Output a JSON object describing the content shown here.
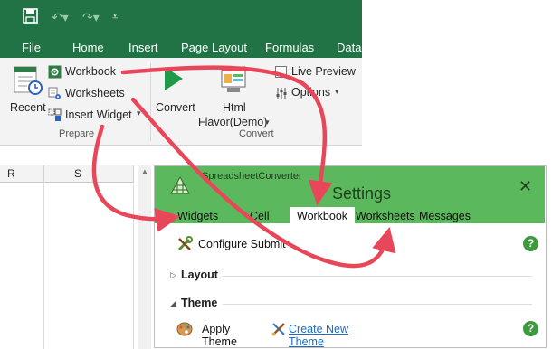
{
  "colors": {
    "excel_green": "#217346",
    "pane_green": "#5cb85c",
    "arrow_red": "#e8475a",
    "link_blue": "#1a6ec7"
  },
  "excel": {
    "qat": {
      "save_icon": "save-icon",
      "undo_icon": "undo-icon",
      "redo_icon": "redo-icon",
      "customize_icon": "customize-icon"
    },
    "tabs": [
      "File",
      "Home",
      "Insert",
      "Page Layout",
      "Formulas",
      "Data"
    ],
    "ribbon": {
      "recent_label": "Recent",
      "workbook_label": "Workbook",
      "worksheets_label": "Worksheets",
      "insert_widget_label": "Insert Widget",
      "prepare_group": "Prepare",
      "convert_label": "Convert",
      "html_label": "Html",
      "flavor_label": "Flavor(Demo)",
      "live_preview_label": "Live Preview",
      "options_label": "Options",
      "convert_group": "Convert"
    },
    "columns": [
      "R",
      "S"
    ]
  },
  "pane": {
    "brand": "SpreadsheetConverter",
    "title": "Settings",
    "close_glyph": "✕",
    "tabs": [
      "Widgets",
      "Cell",
      "Workbook",
      "Worksheets",
      "Messages"
    ],
    "active_tab": "Workbook",
    "configure_submit": "Configure Submit",
    "layout_section": "Layout",
    "theme_section": "Theme",
    "apply_theme": "Apply Theme",
    "create_new_theme": "Create New Theme",
    "help_glyph": "?"
  }
}
